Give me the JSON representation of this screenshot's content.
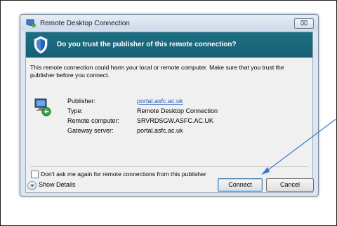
{
  "window": {
    "title": "Remote Desktop Connection",
    "close_label": "⌧"
  },
  "banner": {
    "question": "Do you trust the publisher of this remote connection?"
  },
  "warning_text": "This remote connection could harm your local or remote computer. Make sure that you trust the publisher before you connect.",
  "details": {
    "fields": [
      {
        "label": "Publisher:",
        "value": "portal.asfc.ac.uk"
      },
      {
        "label": "Type:",
        "value": "Remote Desktop Connection"
      },
      {
        "label": "Remote computer:",
        "value": "SRVRDSGW.ASFC.AC.UK"
      },
      {
        "label": "Gateway server:",
        "value": "portal.asfc.ac.uk"
      }
    ]
  },
  "checkbox": {
    "label": "Don't ask me again for remote connections from this publisher",
    "checked": false
  },
  "show_details_label": "Show Details",
  "buttons": {
    "connect": "Connect",
    "cancel": "Cancel"
  },
  "colors": {
    "banner": "#1a6a7e",
    "link": "#1f5fbf",
    "annotation_arrow": "#3b7ac9"
  },
  "icons": [
    "rdc-app-icon",
    "shield-icon",
    "remote-computer-icon",
    "chevron-down-icon"
  ]
}
